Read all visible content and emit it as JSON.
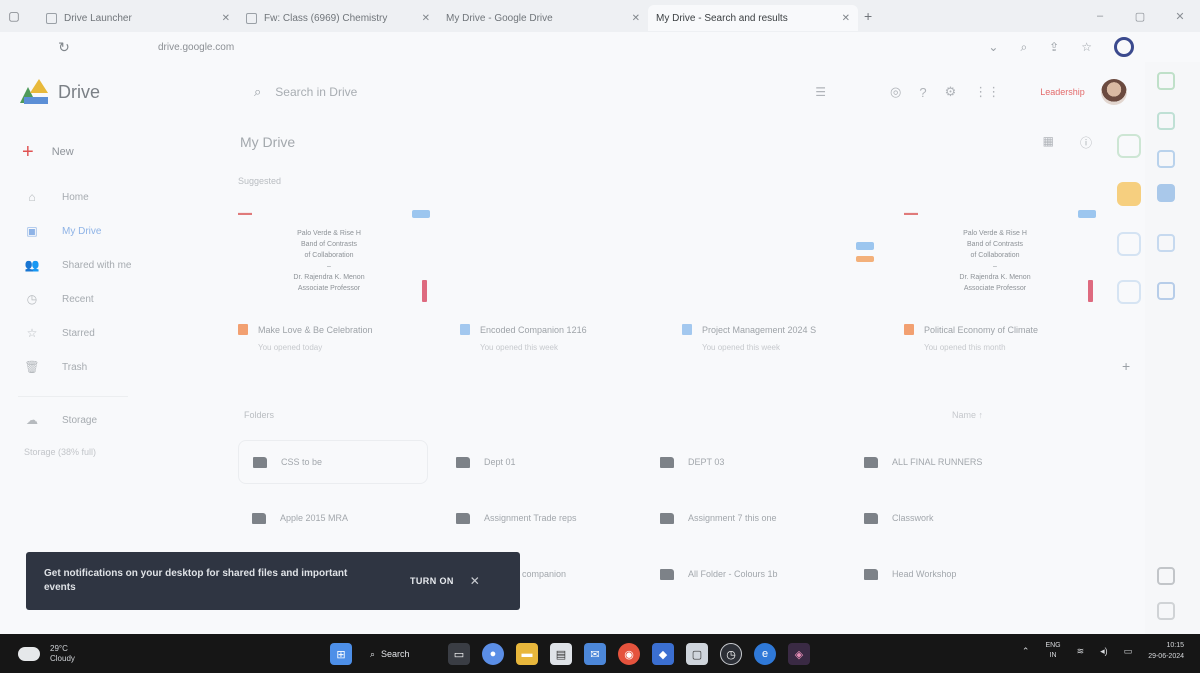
{
  "browser": {
    "tabs": [
      {
        "title": "Drive Launcher",
        "active": false
      },
      {
        "title": "Fw: Class (6969) Chemistry",
        "active": false
      },
      {
        "title": "My Drive - Google Drive",
        "active": false
      },
      {
        "title": "My Drive - Search and results",
        "active": true
      }
    ],
    "url": "drive.google.com"
  },
  "drive": {
    "logo_text": "Drive",
    "search_placeholder": "Search in Drive",
    "org_badge": "Leadership",
    "nav": {
      "new_label": "New",
      "items": [
        {
          "label": "Home",
          "icon": "home-icon",
          "active": false
        },
        {
          "label": "My Drive",
          "icon": "my-drive-icon",
          "active": true
        },
        {
          "label": "Shared with me",
          "icon": "shared-icon",
          "active": false
        },
        {
          "label": "Recent",
          "icon": "clock-icon",
          "active": false
        },
        {
          "label": "Starred",
          "icon": "star-icon",
          "active": false
        },
        {
          "label": "Trash",
          "icon": "trash-icon",
          "active": false
        },
        {
          "label": "Storage",
          "icon": "cloud-icon",
          "active": false
        }
      ],
      "storage_text": "Storage (38% full)"
    },
    "page_title": "My Drive",
    "suggested_label": "Suggested",
    "suggested": [
      {
        "name": "Make Love & Be Celebration",
        "sub": "You opened today",
        "icon_color": "#f2a071",
        "thumb_lines": [
          "Palo Verde & Rise H",
          "Band of Contrasts",
          "of Collaboration",
          "–",
          "Dr. Rajendra K. Menon",
          "Associate Professor"
        ]
      },
      {
        "name": "Encoded Companion 1216",
        "sub": "You opened this week",
        "icon_color": "#a3c8ef",
        "thumb_lines": []
      },
      {
        "name": "Project Management 2024 S",
        "sub": "You opened this week",
        "icon_color": "#a3c8ef",
        "thumb_lines": []
      },
      {
        "name": "Political Economy of Climate",
        "sub": "You opened this month",
        "icon_color": "#f2a071",
        "thumb_lines": [
          "Palo Verde & Rise H",
          "Band of Contrasts",
          "of Collaboration",
          "–",
          "Dr. Rajendra K. Menon",
          "Associate Professor"
        ]
      }
    ],
    "folders_label": "Folders",
    "folders_sort": "Name ↑",
    "folders": [
      "CSS to be",
      "Dept 01",
      "DEPT 03",
      "ALL FINAL RUNNERS",
      "Apple 2015 MRA",
      "Assignment Trade reps",
      "Assignment 7 this one",
      "Classwork",
      "",
      "Encoded companion",
      "All Folder - Colours 1b",
      "Head Workshop"
    ]
  },
  "snackbar": {
    "message": "Get notifications on your desktop for shared files and important events",
    "action": "TURN ON"
  },
  "taskbar": {
    "weather_temp": "29°C",
    "weather_desc": "Cloudy",
    "search_label": "Search",
    "lang_top": "ENG",
    "lang_bottom": "IN",
    "time": "10:15",
    "date": "29-06-2024"
  }
}
